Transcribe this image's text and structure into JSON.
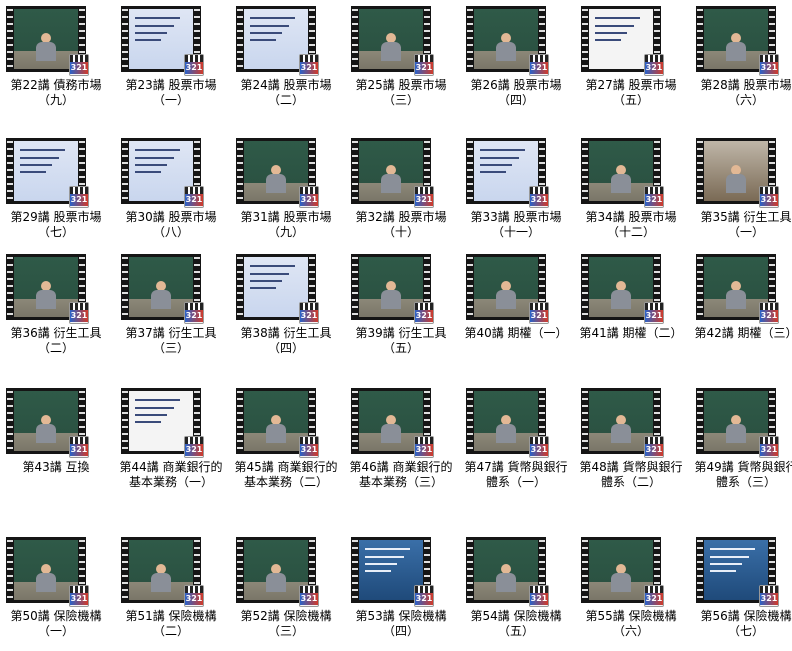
{
  "brand_logo_text": "321",
  "items": [
    {
      "label": "第22講 債務市場（九）",
      "scene": "board"
    },
    {
      "label": "第23講 股票市場（一）",
      "scene": "slide"
    },
    {
      "label": "第24講 股票市場（二）",
      "scene": "slide"
    },
    {
      "label": "第25講 股票市場（三）",
      "scene": "board"
    },
    {
      "label": "第26講 股票市場（四）",
      "scene": "board"
    },
    {
      "label": "第27講 股票市場（五）",
      "scene": "table"
    },
    {
      "label": "第28講 股票市場（六）",
      "scene": "board"
    },
    {
      "label": "第29講 股票市場（七）",
      "scene": "slide"
    },
    {
      "label": "第30講 股票市場（八）",
      "scene": "slide"
    },
    {
      "label": "第31講 股票市場（九）",
      "scene": "board"
    },
    {
      "label": "第32講 股票市場（十）",
      "scene": "board"
    },
    {
      "label": "第33講 股票市場（十一）",
      "scene": "slide"
    },
    {
      "label": "第34講 股票市場（十二）",
      "scene": "board"
    },
    {
      "label": "第35講 衍生工具（一）",
      "scene": "room"
    },
    {
      "label": "第36講 衍生工具（二）",
      "scene": "board"
    },
    {
      "label": "第37講 衍生工具（三）",
      "scene": "board"
    },
    {
      "label": "第38講 衍生工具（四）",
      "scene": "slide"
    },
    {
      "label": "第39講 衍生工具（五）",
      "scene": "board"
    },
    {
      "label": "第40講 期權（一）",
      "scene": "board"
    },
    {
      "label": "第41講 期權（二）",
      "scene": "board"
    },
    {
      "label": "第42講 期權（三）",
      "scene": "board"
    },
    {
      "label": "第43講 互換",
      "scene": "board"
    },
    {
      "label": "第44講 商業銀行的基本業務（一）",
      "scene": "table"
    },
    {
      "label": "第45講 商業銀行的基本業務（二）",
      "scene": "board"
    },
    {
      "label": "第46講 商業銀行的基本業務（三）",
      "scene": "board"
    },
    {
      "label": "第47講 貨幣與銀行體系（一）",
      "scene": "board"
    },
    {
      "label": "第48講 貨幣與銀行體系（二）",
      "scene": "board"
    },
    {
      "label": "第49講 貨幣與銀行體系（三）",
      "scene": "board"
    },
    {
      "label": "第50講 保險機構（一）",
      "scene": "board"
    },
    {
      "label": "第51講 保險機構（二）",
      "scene": "board"
    },
    {
      "label": "第52講 保險機構（三）",
      "scene": "board"
    },
    {
      "label": "第53講 保險機構（四）",
      "scene": "dark"
    },
    {
      "label": "第54講 保險機構（五）",
      "scene": "board"
    },
    {
      "label": "第55講 保險機構（六）",
      "scene": "board"
    },
    {
      "label": "第56講 保險機構（七）",
      "scene": "dark"
    }
  ]
}
